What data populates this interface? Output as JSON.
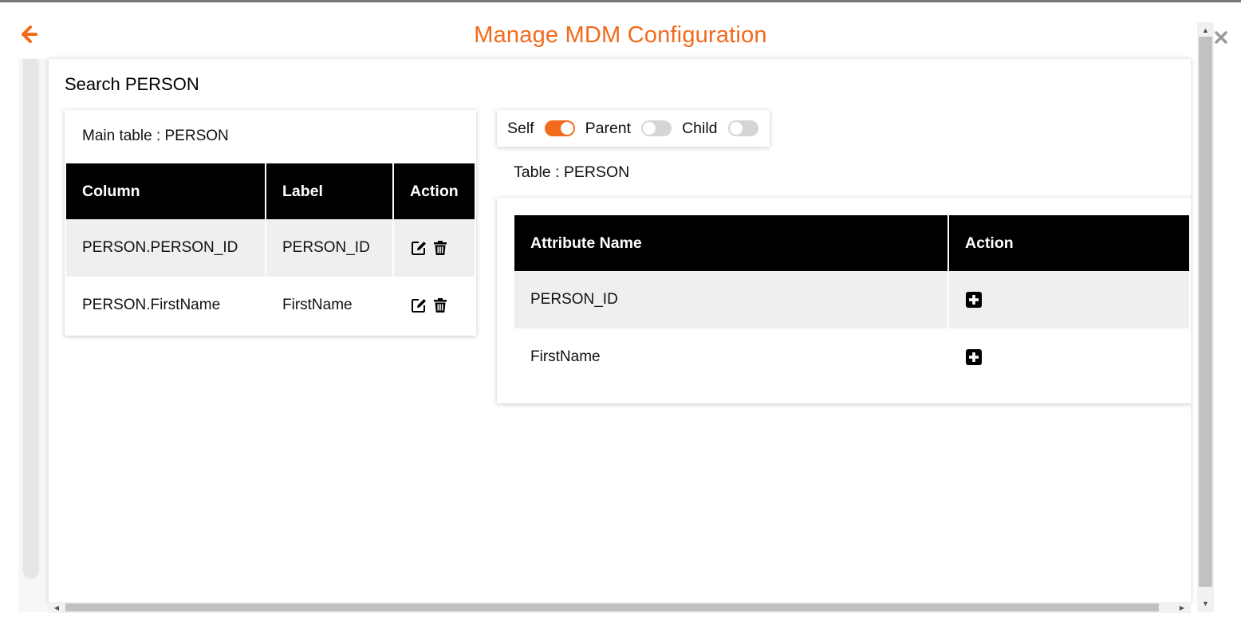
{
  "header": {
    "title": "Manage MDM Configuration",
    "back_icon": "arrow-left-icon",
    "close_icon": "close-icon",
    "accent_color": "#f26a1b"
  },
  "search": {
    "title": "Search PERSON"
  },
  "main_table": {
    "label": "Main table : PERSON",
    "headers": [
      "Column",
      "Label",
      "Action"
    ],
    "rows": [
      {
        "column": "PERSON.PERSON_ID",
        "label": "PERSON_ID"
      },
      {
        "column": "PERSON.FirstName",
        "label": "FirstName"
      }
    ],
    "row_icons": [
      "edit-icon",
      "trash-icon"
    ]
  },
  "relation_toggles": [
    {
      "label": "Self",
      "on": true
    },
    {
      "label": "Parent",
      "on": false
    },
    {
      "label": "Child",
      "on": false
    }
  ],
  "attribute_table": {
    "label": "Table : PERSON",
    "headers": [
      "Attribute Name",
      "Action"
    ],
    "rows": [
      {
        "name": "PERSON_ID"
      },
      {
        "name": "FirstName"
      }
    ],
    "row_icon": "plus-square-icon"
  }
}
